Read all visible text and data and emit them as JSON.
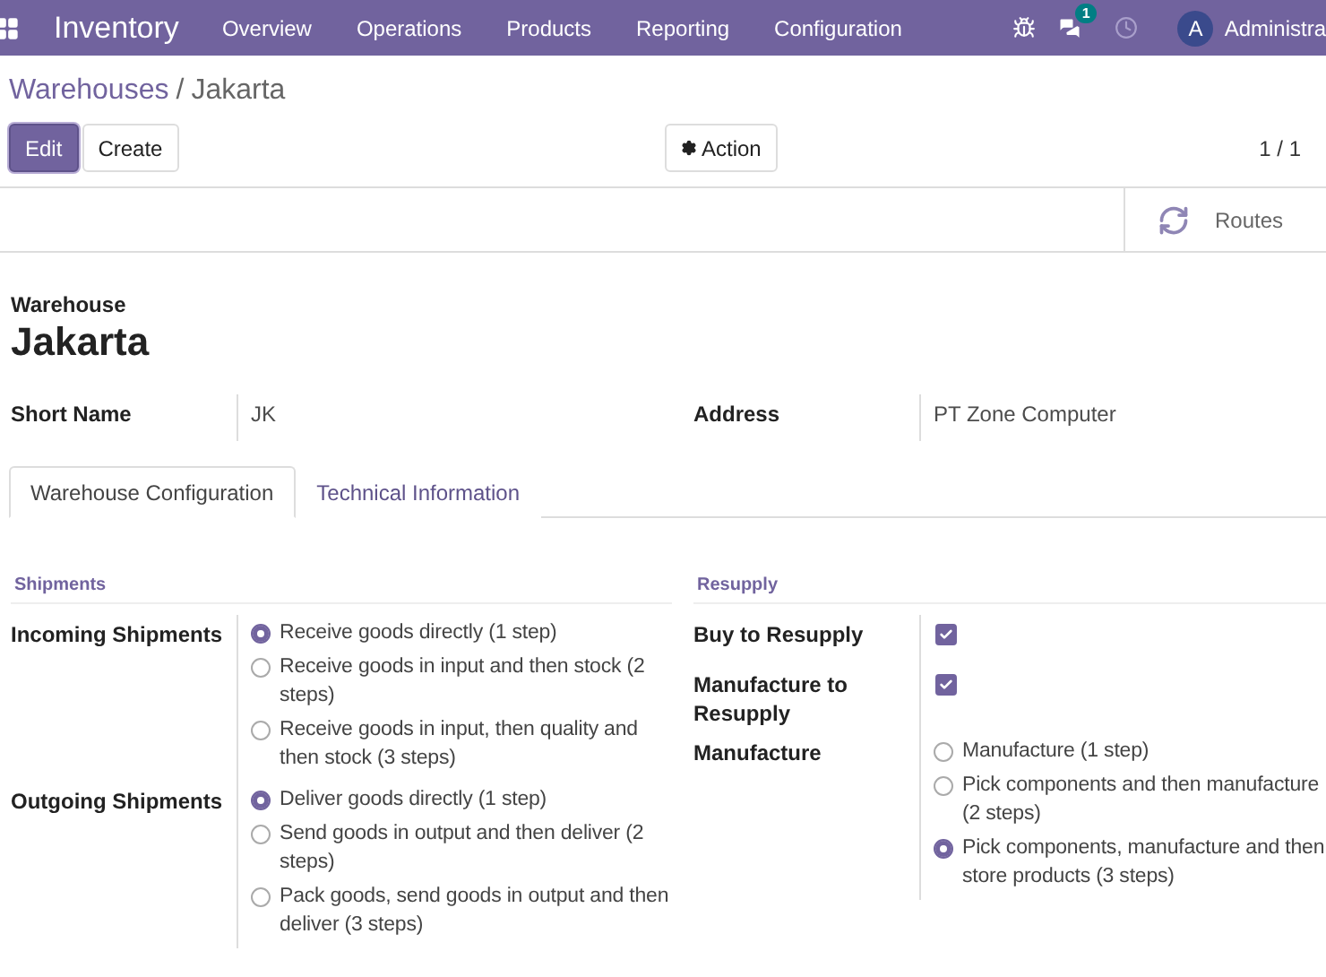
{
  "navbar": {
    "app": "Inventory",
    "menu": [
      "Overview",
      "Operations",
      "Products",
      "Reporting",
      "Configuration"
    ],
    "chat_count": "1",
    "user_initial": "A",
    "user_name": "Administra"
  },
  "breadcrumb": {
    "parent": "Warehouses",
    "separator": "/",
    "current": "Jakarta"
  },
  "controls": {
    "edit": "Edit",
    "create": "Create",
    "action": "Action",
    "pager": "1 / 1"
  },
  "smart_buttons": [
    {
      "label": "Routes"
    }
  ],
  "record": {
    "label": "Warehouse",
    "name": "Jakarta"
  },
  "fields": [
    {
      "label": "Short Name",
      "value": "JK"
    },
    {
      "label": "Address",
      "value": "PT Zone Computer"
    }
  ],
  "tabs": [
    {
      "label": "Warehouse Configuration",
      "selected": true
    },
    {
      "label": "Technical Information",
      "selected": false
    }
  ],
  "groups": [
    {
      "title": "Shipments",
      "rows": [
        {
          "label": "Incoming Shipments",
          "kind": "radio",
          "options": [
            {
              "label": "Receive goods directly (1 step)",
              "selected": true
            },
            {
              "label": "Receive goods in input and then stock (2 steps)",
              "selected": false
            },
            {
              "label": "Receive goods in input, then quality and then stock (3 steps)",
              "selected": false
            }
          ]
        },
        {
          "label": "Outgoing Shipments",
          "kind": "radio",
          "options": [
            {
              "label": "Deliver goods directly (1 step)",
              "selected": true
            },
            {
              "label": "Send goods in output and then deliver (2 steps)",
              "selected": false
            },
            {
              "label": "Pack goods, send goods in output and then deliver (3 steps)",
              "selected": false
            }
          ]
        }
      ]
    },
    {
      "title": "Resupply",
      "rows": [
        {
          "label": "Buy to Resupply",
          "kind": "checkbox",
          "checked": true
        },
        {
          "label": "Manufacture to Resupply",
          "kind": "checkbox",
          "checked": true
        },
        {
          "label": "Manufacture",
          "kind": "radio",
          "options": [
            {
              "label": "Manufacture (1 step)",
              "selected": false
            },
            {
              "label": "Pick components and then manufacture (2 steps)",
              "selected": false
            },
            {
              "label": "Pick components, manufacture and then store products (3 steps)",
              "selected": true
            }
          ]
        }
      ]
    }
  ]
}
